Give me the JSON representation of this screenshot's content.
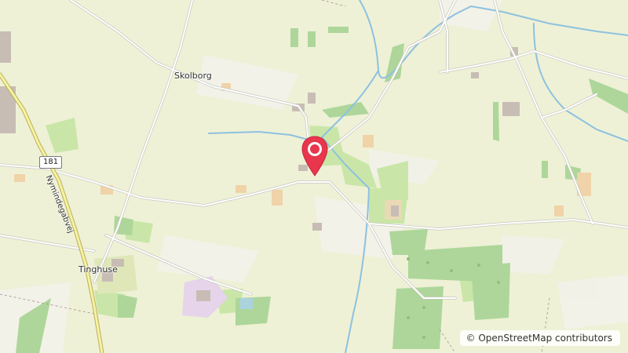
{
  "map": {
    "places": {
      "skolborg": "Skolborg",
      "tinghuse": "Tinghuse"
    },
    "roads": {
      "route_shield": "181",
      "nymindegabvej": "Nymindegabvej"
    },
    "marker": {
      "icon": "map-pin-icon",
      "color": "#e8364c"
    },
    "attribution": "© OpenStreetMap contributors"
  }
}
